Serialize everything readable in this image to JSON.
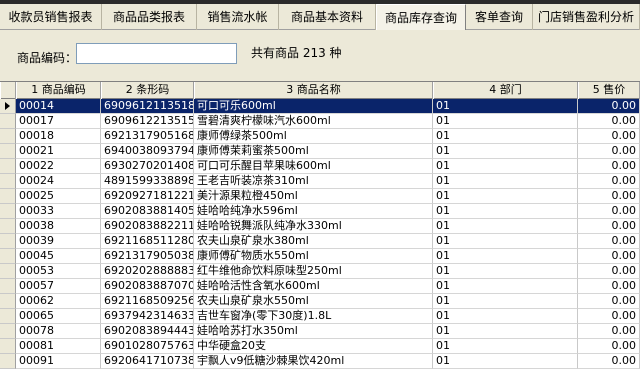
{
  "tabs": [
    {
      "label": "收款员销售报表"
    },
    {
      "label": "商品品类报表"
    },
    {
      "label": "销售流水帐"
    },
    {
      "label": "商品基本资料"
    },
    {
      "label": "商品库存查询",
      "active": true
    },
    {
      "label": "客单查询"
    },
    {
      "label": "门店销售盈利分析"
    }
  ],
  "filter": {
    "code_label": "商品编码：",
    "code_value": "",
    "total_text": "共有商品 213 种"
  },
  "grid": {
    "columns": [
      "1 商品编码",
      "2 条形码",
      "3 商品名称",
      "4 部门",
      "5 售价"
    ],
    "rows": [
      [
        "00014",
        "6909612113518",
        "可口可乐600ml",
        "01",
        "0.00"
      ],
      [
        "00017",
        "6909612213515",
        "雪碧清爽柠檬味汽水600ml",
        "01",
        "0.00"
      ],
      [
        "00018",
        "6921317905168",
        "康师傅绿茶500ml",
        "01",
        "0.00"
      ],
      [
        "00021",
        "6940038093794",
        "康师傅茉莉蜜茶500ml",
        "01",
        "0.00"
      ],
      [
        "00022",
        "6930270201408",
        "可口可乐醒目苹果味600ml",
        "01",
        "0.00"
      ],
      [
        "00024",
        "4891599338898",
        "王老吉听装凉茶310ml",
        "01",
        "0.00"
      ],
      [
        "00025",
        "6920927181221",
        "美汁源果粒橙450ml",
        "01",
        "0.00"
      ],
      [
        "00033",
        "6902083881405",
        "娃哈哈纯净水596ml",
        "01",
        "0.00"
      ],
      [
        "00038",
        "6902083882211",
        "娃哈哈锐舞派队纯净水330ml",
        "01",
        "0.00"
      ],
      [
        "00039",
        "6921168511280",
        "农夫山泉矿泉水380ml",
        "01",
        "0.00"
      ],
      [
        "00045",
        "6921317905038",
        "康师傅矿物质水550ml",
        "01",
        "0.00"
      ],
      [
        "00053",
        "6920202888883",
        "红牛维他命饮料原味型250ml",
        "01",
        "0.00"
      ],
      [
        "00057",
        "6902083887070",
        "娃哈哈活性含氧水600ml",
        "01",
        "0.00"
      ],
      [
        "00062",
        "6921168509256",
        "农夫山泉矿泉水550ml",
        "01",
        "0.00"
      ],
      [
        "00065",
        "6937942314633",
        "吉世车窗净(零下30度)1.8L",
        "01",
        "0.00"
      ],
      [
        "00078",
        "6902083894443",
        "娃哈哈苏打水350ml",
        "01",
        "0.00"
      ],
      [
        "00081",
        "6901028075763",
        "中华硬盒20支",
        "01",
        "0.00"
      ],
      [
        "00091",
        "6920641710738",
        "宇飘人v9低糖沙棘果饮420ml",
        "01",
        "0.00"
      ]
    ]
  },
  "colors": {
    "selection": "#0a246a",
    "chrome": "#ece9d8"
  }
}
